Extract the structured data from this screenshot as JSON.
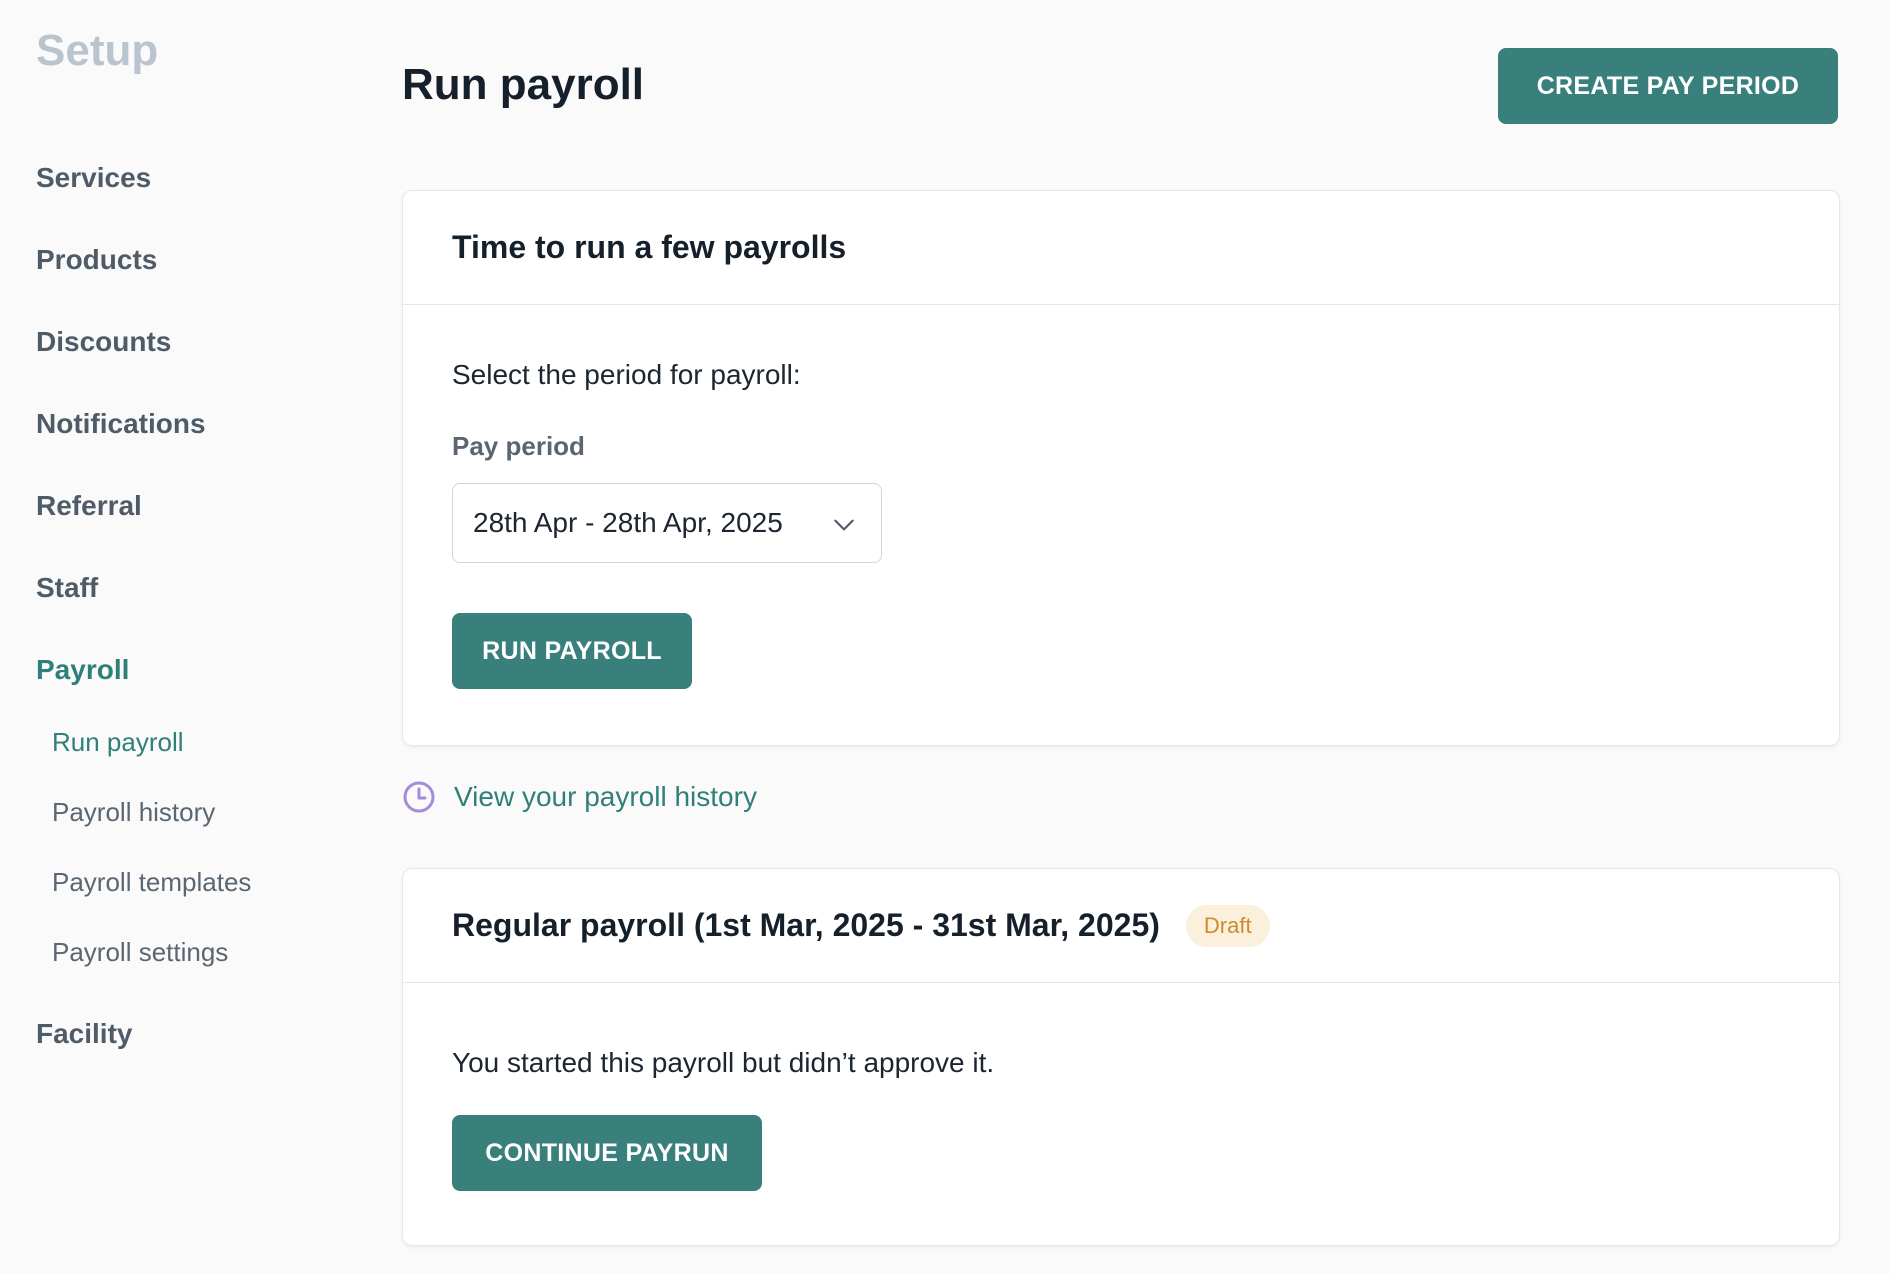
{
  "sidebar": {
    "title": "Setup",
    "items": [
      {
        "label": "Services"
      },
      {
        "label": "Products"
      },
      {
        "label": "Discounts"
      },
      {
        "label": "Notifications"
      },
      {
        "label": "Referral"
      },
      {
        "label": "Staff"
      },
      {
        "label": "Payroll"
      },
      {
        "label": "Facility"
      }
    ],
    "payroll_subitems": [
      {
        "label": "Run payroll"
      },
      {
        "label": "Payroll history"
      },
      {
        "label": "Payroll templates"
      },
      {
        "label": "Payroll settings"
      }
    ]
  },
  "header": {
    "title": "Run payroll",
    "create_button": "CREATE PAY PERIOD"
  },
  "run_card": {
    "title": "Time to run a few payrolls",
    "instruction": "Select the period for payroll:",
    "field_label": "Pay period",
    "selected_period": "28th Apr - 28th Apr, 2025",
    "run_button": "RUN PAYROLL"
  },
  "history_link": {
    "label": "View your payroll history"
  },
  "draft_card": {
    "title": "Regular payroll (1st Mar, 2025 - 31st Mar, 2025)",
    "badge": "Draft",
    "message": "You started this payroll but didn’t approve it.",
    "continue_button": "CONTINUE PAYRUN"
  },
  "colors": {
    "accent": "#397f7b",
    "active_nav": "#2f7f7a",
    "badge_bg": "#fbf0dc",
    "badge_text": "#d08a2a",
    "clock_icon": "#a78bdb"
  }
}
